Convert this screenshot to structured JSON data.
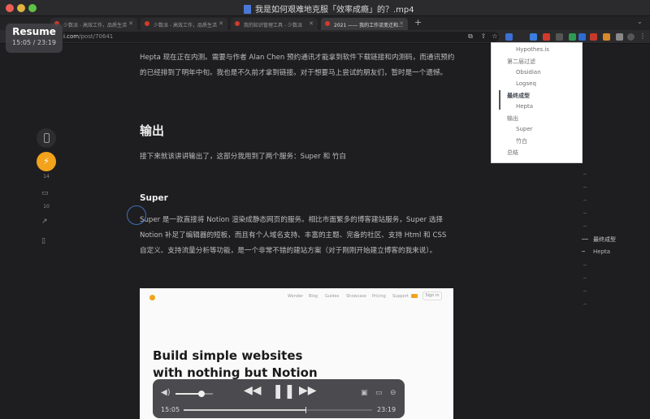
{
  "window": {
    "title": "我是如何艰难地克服「效率成瘾」的？.mp4"
  },
  "tabs": [
    {
      "label": "少数派 - 高效工作，品质生活"
    },
    {
      "label": "少数派 - 高效工作，品质生活"
    },
    {
      "label": "我的知识管理工具 - 少数派"
    },
    {
      "label": "2021 —— 我的工作流变迁和…",
      "active": true
    }
  ],
  "address_bar": {
    "url_dim": "",
    "url_domain": "i.com",
    "url_path": "/post/70641"
  },
  "overlay": {
    "resume_label": "Resume",
    "time": "15:05 / 23:19"
  },
  "article": {
    "intro": "Hepta 现在正在内测。需要与作者 Alan Chen 预约通讯才能拿到软件下载链接和内测码，而通讯预约的已经排到了明年中旬。我也是不久前才拿到链接。对于想要马上尝试的朋友们，暂时是一个遗憾。",
    "heading_output": "输出",
    "output_text": "接下来就该讲讲输出了，这部分我用到了两个服务：Super 和 竹白",
    "heading_super": "Super",
    "super_text": "Super 是一款直接将 Notion 渲染成静态网页的服务。相比市面繁多的博客建站服务，Super 选择 Notion 补足了编辑器的短板，而且有个人域名支持、丰富的主题、完备的社区、支持 Html 和 CSS 自定义、支持流量分析等功能，是一个非常不错的建站方案（对于刚刚开始建立博客的我来说）。"
  },
  "rail": {
    "like_count": "14",
    "comment_count": "10"
  },
  "toc": {
    "items": [
      {
        "label": "Hypothes.is",
        "level": 2
      },
      {
        "label": "第二层过滤",
        "level": 1
      },
      {
        "label": "Obsidian",
        "level": 2
      },
      {
        "label": "Logseq",
        "level": 2
      },
      {
        "label": "最终成型",
        "level": 1,
        "active": true
      },
      {
        "label": "Hepta",
        "level": 2
      },
      {
        "label": "输出",
        "level": 1
      },
      {
        "label": "Super",
        "level": 2
      },
      {
        "label": "竹白",
        "level": 2
      },
      {
        "label": "总结",
        "level": 1
      }
    ]
  },
  "mini_toc": {
    "active": "最终成型",
    "sub": "Hepta"
  },
  "embed": {
    "nav": [
      "Wonder",
      "Blog",
      "Guides",
      "Showcase",
      "Pricing",
      "Support"
    ],
    "sign_in": "Sign in",
    "hero_line1": "Build simple websites",
    "hero_line2": "with nothing but Notion"
  },
  "player": {
    "current": "15:05",
    "total": "23:19",
    "progress": 0.647,
    "volume": 0.7
  }
}
